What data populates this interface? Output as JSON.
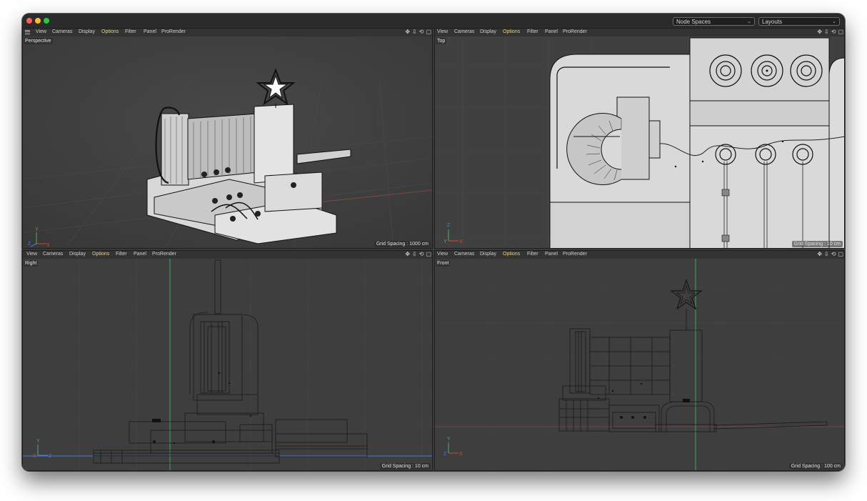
{
  "window": {
    "dropdowns": {
      "node_spaces": "Node Spaces",
      "layouts": "Layouts"
    }
  },
  "viewports": {
    "perspective": {
      "name": "Perspective",
      "menu": [
        "View",
        "Cameras",
        "Display",
        "Options",
        "Filter",
        "Panel",
        "ProRender"
      ],
      "active_menu": "Options",
      "grid_spacing": "Grid Spacing : 1000 cm",
      "axes": [
        "Y",
        "Z",
        "X"
      ]
    },
    "top": {
      "name": "Top",
      "menu": [
        "View",
        "Cameras",
        "Display",
        "Options",
        "Filter",
        "Panel",
        "ProRender"
      ],
      "active_menu": "Options",
      "grid_spacing": "Grid Spacing : 10 cm",
      "axes": [
        "Z",
        "Y",
        "X"
      ]
    },
    "right": {
      "name": "Right",
      "menu": [
        "View",
        "Cameras",
        "Display",
        "Options",
        "Filter",
        "Panel",
        "ProRender"
      ],
      "active_menu": "Options",
      "grid_spacing": "Grid Spacing : 10 cm",
      "axes": [
        "Y",
        "X",
        "Z"
      ]
    },
    "front": {
      "name": "Front",
      "menu": [
        "View",
        "Cameras",
        "Display",
        "Options",
        "Filter",
        "Panel",
        "ProRender"
      ],
      "active_menu": "Options",
      "grid_spacing": "Grid Spacing : 100 cm",
      "axes": [
        "Y",
        "Z",
        "X"
      ]
    }
  },
  "colors": {
    "window_bg": "#3a3a3a",
    "menubar_bg": "#333333",
    "active_menu": "#e8d28a",
    "axis_y": "#4caf6a",
    "axis_x": "#d24a3c",
    "axis_z": "#4a7ad2"
  },
  "icons": [
    "move-view-icon",
    "pan-view-icon",
    "rotate-view-icon",
    "maximize-view-icon"
  ]
}
